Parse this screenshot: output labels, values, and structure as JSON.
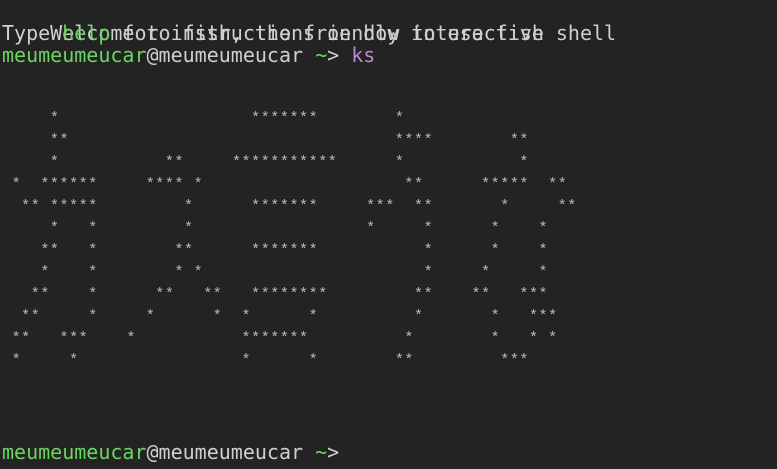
{
  "terminal": {
    "greeting": {
      "line1": "Welcome to fish, the friendly interactive shell",
      "line2_prefix": "Type ",
      "line2_help": "help",
      "line2_suffix": " for instructions on how to use fish"
    },
    "prompt1": {
      "user": "meumeumeucar",
      "at": "@",
      "host": "meumeumeucar",
      "cwd": "~",
      "arrow": ">",
      "command": "ks"
    },
    "ascii_art": [
      "     *                    *******        *",
      "     **                                  ****        **",
      "     *           **     ***********      *            *",
      " *  ******     **** *                     **      *****  **",
      "  ** *****         *      *******     ***  **       *     **",
      "     *   *         *                  *     *      *    *",
      "    **   *        **      *******           *      *    *",
      "    *    *        * *                       *     *     *",
      "   **    *      **   **   ********         **    **   ***",
      "  **     *     *      *  *      *          *       *   ***",
      " **   ***    *           *******          *        *   * *",
      " *     *                 *      *        **         ***"
    ],
    "prompt2": {
      "user": "meumeumeucar",
      "at": "@",
      "host": "meumeumeucar",
      "cwd": "~",
      "arrow": ">"
    }
  }
}
